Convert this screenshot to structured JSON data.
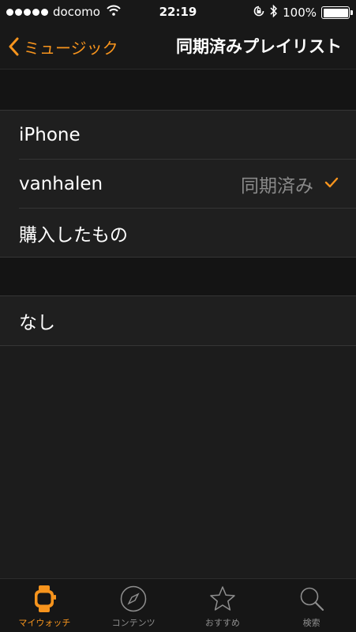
{
  "status_bar": {
    "carrier": "docomo",
    "time": "22:19",
    "battery": "100%",
    "signal_bars": 5
  },
  "nav": {
    "back_label": "ミュージック",
    "title": "同期済みプレイリスト"
  },
  "section1": {
    "rows": [
      {
        "label": "iPhone",
        "detail": "",
        "checked": false
      },
      {
        "label": "vanhalen",
        "detail": "同期済み",
        "checked": true
      },
      {
        "label": "購入したもの",
        "detail": "",
        "checked": false
      }
    ]
  },
  "section2": {
    "rows": [
      {
        "label": "なし"
      }
    ]
  },
  "tab_bar": {
    "tabs": [
      {
        "label": "マイウォッチ",
        "icon": "watch-icon",
        "active": true
      },
      {
        "label": "コンテンツ",
        "icon": "compass-icon",
        "active": false
      },
      {
        "label": "おすすめ",
        "icon": "star-icon",
        "active": false
      },
      {
        "label": "検索",
        "icon": "search-icon",
        "active": false
      }
    ]
  },
  "colors": {
    "accent": "#f7941d",
    "background": "#1c1c1c",
    "row_background": "#1f1f1f",
    "detail_text": "#8a8a8a"
  }
}
